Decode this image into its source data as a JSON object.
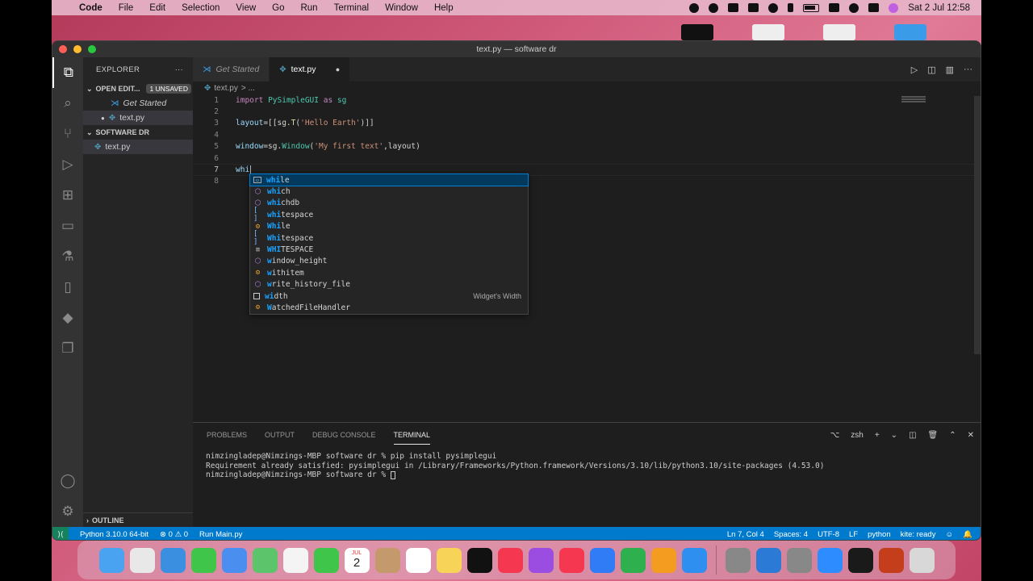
{
  "menubar": {
    "apple": "",
    "app": "Code",
    "items": [
      "File",
      "Edit",
      "Selection",
      "View",
      "Go",
      "Run",
      "Terminal",
      "Window",
      "Help"
    ],
    "datetime": "Sat 2 Jul  12:58"
  },
  "window": {
    "title": "text.py — software dr"
  },
  "sidebar": {
    "explorer_title": "EXPLORER",
    "more": "···",
    "open_editors": "OPEN EDIT...",
    "unsaved_badge": "1 UNSAVED",
    "open_items": [
      {
        "label": "Get Started"
      },
      {
        "label": "text.py"
      }
    ],
    "folder": "SOFTWARE DR",
    "files": [
      {
        "label": "text.py"
      }
    ],
    "outline": "OUTLINE"
  },
  "tabs": [
    {
      "label": "Get Started"
    },
    {
      "label": "text.py",
      "modified": "●"
    }
  ],
  "breadcrumb": {
    "file": "text.py",
    "sep": "> ..."
  },
  "code": {
    "lines": [
      {
        "num": "1"
      },
      {
        "num": "2"
      },
      {
        "num": "3"
      },
      {
        "num": "4"
      },
      {
        "num": "5"
      },
      {
        "num": "6"
      },
      {
        "num": "7"
      },
      {
        "num": "8"
      }
    ],
    "l1_kw": "import",
    "l1_mod": "PySimpleGUI",
    "l1_as": "as",
    "l1_alias": "sg",
    "l3_var": "layout",
    "l3_mid": "=[[sg.",
    "l3_fn": "T",
    "l3_open": "(",
    "l3_str": "'Hello Earth'",
    "l3_close": ")]]",
    "l5_var": "window",
    "l5_mid": "=sg.",
    "l5_cls": "Window",
    "l5_open": "(",
    "l5_str": "'My first text'",
    "l5_rest": ",layout)",
    "l7_text": "whi"
  },
  "suggestions": [
    {
      "icon": "keyword",
      "pre": "",
      "hl": "whi",
      "post": "le",
      "detail": ""
    },
    {
      "icon": "module",
      "pre": "",
      "hl": "whi",
      "post": "ch",
      "detail": ""
    },
    {
      "icon": "module",
      "pre": "",
      "hl": "whi",
      "post": "chdb",
      "detail": ""
    },
    {
      "icon": "variable",
      "pre": "",
      "hl": "whi",
      "post": "tespace",
      "detail": ""
    },
    {
      "icon": "class",
      "pre": "",
      "hl": "Whi",
      "post": "le",
      "detail": ""
    },
    {
      "icon": "variable",
      "pre": "",
      "hl": "Whi",
      "post": "tespace",
      "detail": ""
    },
    {
      "icon": "constant",
      "pre": "",
      "hl": "WHI",
      "post": "TESPACE",
      "detail": ""
    },
    {
      "icon": "module",
      "pre": "",
      "hl": "w",
      "post": "indow_height",
      "detail": ""
    },
    {
      "icon": "class",
      "pre": "",
      "hl": "w",
      "post": "ithitem",
      "detail": ""
    },
    {
      "icon": "module",
      "pre": "",
      "hl": "w",
      "post": "rite_history_file",
      "detail": ""
    },
    {
      "icon": "property",
      "pre": "",
      "hl": "wi",
      "post": "dth",
      "detail": "Widget's Width"
    },
    {
      "icon": "class",
      "pre": "",
      "hl": "W",
      "post": "atchedFileHandler",
      "detail": ""
    }
  ],
  "panel": {
    "tabs": [
      "PROBLEMS",
      "OUTPUT",
      "DEBUG CONSOLE",
      "TERMINAL"
    ],
    "active_tab": "TERMINAL",
    "shell": "zsh",
    "terminal_lines": [
      "nimzingladep@Nimzings-MBP software dr % pip install pysimplegui",
      "Requirement already satisfied: pysimplegui in /Library/Frameworks/Python.framework/Versions/3.10/lib/python3.10/site-packages (4.53.0)",
      "nimzingladep@Nimzings-MBP software dr % "
    ]
  },
  "statusbar": {
    "remote": "⟩⟨",
    "interpreter": "Python 3.10.0 64-bit",
    "problems": "⊗ 0 ⚠ 0",
    "run": "Run Main.py",
    "position": "Ln 7, Col 4",
    "spaces": "Spaces: 4",
    "encoding": "UTF-8",
    "eol": "LF",
    "language": "python",
    "kite": "kite: ready"
  },
  "dock": {
    "apps": [
      "finder-icon",
      "launchpad-icon",
      "safari-icon",
      "messages-icon",
      "mail-icon",
      "maps-icon",
      "photos-icon",
      "facetime-icon",
      "calendar-icon",
      "contacts-icon",
      "reminders-icon",
      "notes-icon",
      "tv-icon",
      "music-icon",
      "podcasts-icon",
      "news-icon",
      "keynote-icon",
      "numbers-icon",
      "pages-icon",
      "appstore-icon",
      "automator-icon",
      "vscode-icon",
      "settings-icon",
      "zoom-icon",
      "chrome-icon",
      "powerpoint-icon"
    ],
    "calendar_month": "JUL",
    "calendar_day": "2"
  }
}
